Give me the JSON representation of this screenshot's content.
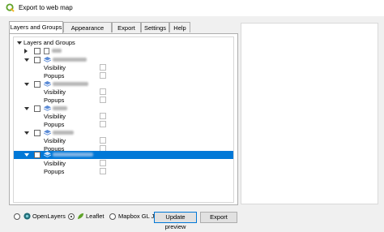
{
  "window": {
    "title": "Export to web map"
  },
  "tabs": [
    {
      "label": "Layers and Groups",
      "active": true
    },
    {
      "label": "Appearance",
      "active": false
    },
    {
      "label": "Export",
      "active": false
    },
    {
      "label": "Settings",
      "active": false
    },
    {
      "label": "Help",
      "active": false
    }
  ],
  "tree": {
    "root_label": "Layers and Groups",
    "visibility_label": "Visibility",
    "popups_label": "Popups"
  },
  "renderer": {
    "options": [
      {
        "label": "OpenLayers",
        "selected": false
      },
      {
        "label": "Leaflet",
        "selected": true
      },
      {
        "label": "Mapbox GL JS",
        "selected": false
      }
    ]
  },
  "buttons": {
    "update_preview": "Update preview",
    "export": "Export"
  },
  "colors": {
    "selection": "#0078d7",
    "qgis_green": "#5fa32a",
    "layer_blue": "#5b8bd6"
  }
}
